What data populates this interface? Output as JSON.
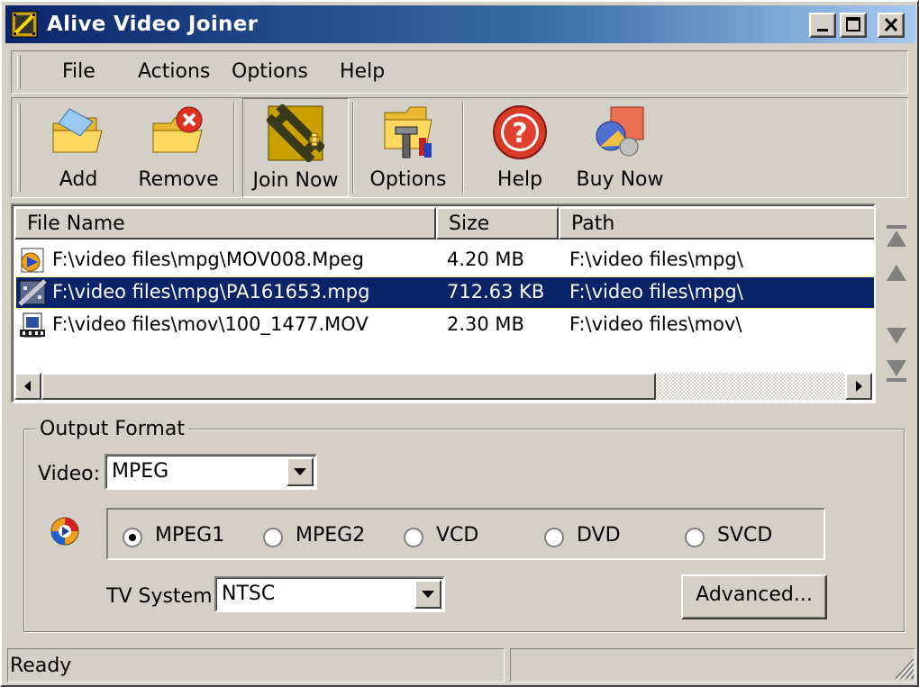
{
  "window": {
    "title": "Alive Video Joiner"
  },
  "menu": {
    "items": [
      {
        "label": "File"
      },
      {
        "label": "Actions"
      },
      {
        "label": "Options"
      },
      {
        "label": "Help"
      }
    ]
  },
  "toolbar": {
    "add": "Add",
    "remove": "Remove",
    "join_now": "Join Now",
    "options": "Options",
    "help": "Help",
    "buy_now": "Buy Now"
  },
  "file_list": {
    "columns": {
      "name": "File Name",
      "size": "Size",
      "path": "Path"
    },
    "rows": [
      {
        "name": "F:\\video files\\mpg\\MOV008.Mpeg",
        "size": "4.20 MB",
        "path": "F:\\video files\\mpg\\"
      },
      {
        "name": "F:\\video files\\mpg\\PA161653.mpg",
        "size": "712.63 KB",
        "path": "F:\\video files\\mpg\\"
      },
      {
        "name": "F:\\video files\\mov\\100_1477.MOV",
        "size": "2.30 MB",
        "path": "F:\\video files\\mov\\"
      }
    ],
    "selected_index": 1
  },
  "output_format": {
    "title": "Output Format",
    "video_label": "Video:",
    "video_value": "MPEG",
    "options": [
      {
        "label": "MPEG1",
        "checked": true
      },
      {
        "label": "MPEG2",
        "checked": false
      },
      {
        "label": "VCD",
        "checked": false
      },
      {
        "label": "DVD",
        "checked": false
      },
      {
        "label": "SVCD",
        "checked": false
      }
    ],
    "tv_system_label": "TV System:",
    "tv_system_value": "NTSC",
    "advanced_button": "Advanced..."
  },
  "status": {
    "text": "Ready"
  },
  "colors": {
    "title_start": "#0a246a",
    "title_end": "#a6caf0",
    "selection": "#0a246a",
    "face": "#d4d0c8"
  }
}
